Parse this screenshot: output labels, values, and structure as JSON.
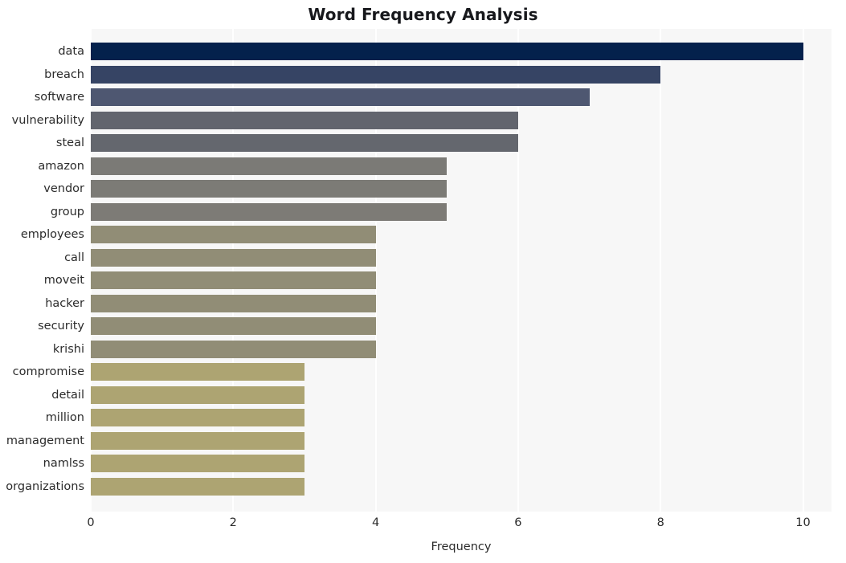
{
  "chart_data": {
    "type": "bar",
    "orientation": "horizontal",
    "title": "Word Frequency Analysis",
    "xlabel": "Frequency",
    "ylabel": "",
    "xlim": [
      0,
      10.4
    ],
    "xticks": [
      0,
      2,
      4,
      6,
      8,
      10
    ],
    "xtick_labels": [
      "0",
      "2",
      "4",
      "6",
      "8",
      "10"
    ],
    "grid": "vertical-white-on-light-gray",
    "legend": "none",
    "categories": [
      "data",
      "breach",
      "software",
      "vulnerability",
      "steal",
      "amazon",
      "vendor",
      "group",
      "employees",
      "call",
      "moveit",
      "hacker",
      "security",
      "krishi",
      "compromise",
      "detail",
      "million",
      "management",
      "namlss",
      "organizations"
    ],
    "values": [
      10,
      8,
      7,
      6,
      6,
      5,
      5,
      5,
      4,
      4,
      4,
      4,
      4,
      4,
      3,
      3,
      3,
      3,
      3,
      3
    ],
    "bar_colors": [
      "#04214c",
      "#364464",
      "#4e5771",
      "#62656e",
      "#64676e",
      "#7b7a76",
      "#7c7b76",
      "#7d7b76",
      "#918d76",
      "#918d76",
      "#918d76",
      "#918d76",
      "#918d76",
      "#918d76",
      "#ada472",
      "#ada472",
      "#ada472",
      "#ada472",
      "#ada472",
      "#ada472"
    ],
    "plot_background": "#f7f7f7",
    "figure_background": "#ffffff",
    "gridline_color": "#ffffff",
    "text_color": "#2b2b2b",
    "title_color": "#17181c"
  }
}
